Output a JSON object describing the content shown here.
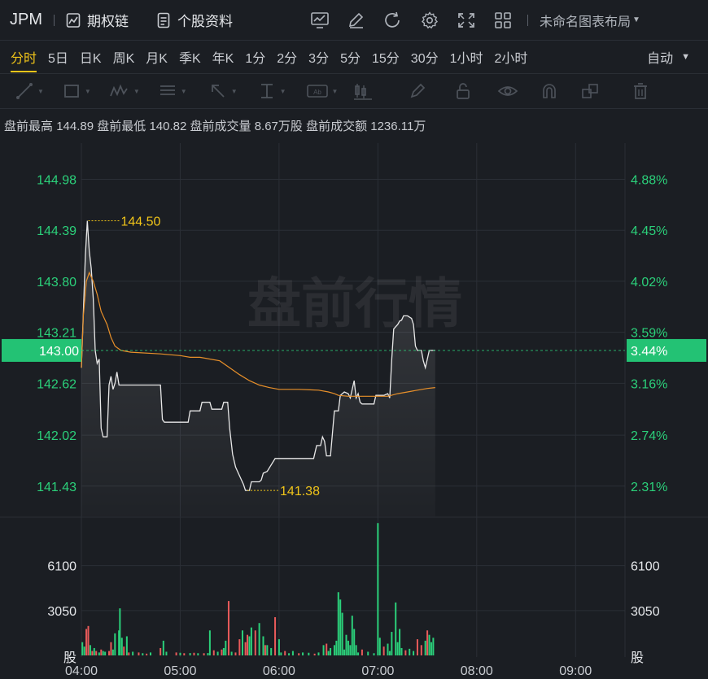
{
  "header": {
    "ticker": "JPM",
    "options_chain": "期权链",
    "profile": "个股资料",
    "layout_name": "未命名图表布局"
  },
  "periods": [
    "分时",
    "5日",
    "日K",
    "周K",
    "月K",
    "季K",
    "年K",
    "1分",
    "2分",
    "3分",
    "5分",
    "15分",
    "30分",
    "1小时",
    "2小时"
  ],
  "active_period": "分时",
  "auto_label": "自动",
  "stats": {
    "high_label": "盘前最高",
    "high": "144.89",
    "low_label": "盘前最低",
    "low": "140.82",
    "vol_label": "盘前成交量",
    "vol": "8.67万股",
    "amt_label": "盘前成交额",
    "amt": "1236.11万"
  },
  "colors": {
    "price_line": "#e8e8e8",
    "avg_line": "#e8902a",
    "up": "#2bd07a",
    "down": "#e85a5a",
    "accent": "#f0c419",
    "label_bg": "#23c274"
  },
  "chart_data": {
    "type": "line",
    "watermark": "盘前行情",
    "price_ticks": [
      "144.98",
      "144.39",
      "143.80",
      "143.21",
      "142.62",
      "142.02",
      "141.43"
    ],
    "pct_ticks": [
      "4.88%",
      "4.45%",
      "4.02%",
      "3.59%",
      "3.16%",
      "2.74%",
      "2.31%"
    ],
    "ylim": [
      141.08,
      145.38
    ],
    "current": {
      "price": "143.00",
      "pct": "3.44%",
      "value": 143.0
    },
    "high_mark": {
      "label": "144.50",
      "x": 4.07,
      "y": 144.5
    },
    "low_mark": {
      "label": "141.38",
      "x": 5.68,
      "y": 141.38
    },
    "x_ticks": [
      "04:00",
      "05:00",
      "06:00",
      "07:00",
      "08:00",
      "09:00"
    ],
    "xlim": [
      4.0,
      9.5
    ],
    "price": [
      [
        4.0,
        142.8
      ],
      [
        4.04,
        144.1
      ],
      [
        4.06,
        144.5
      ],
      [
        4.08,
        144.15
      ],
      [
        4.1,
        143.95
      ],
      [
        4.12,
        143.6
      ],
      [
        4.14,
        143.0
      ],
      [
        4.16,
        142.85
      ],
      [
        4.18,
        142.9
      ],
      [
        4.2,
        142.1
      ],
      [
        4.22,
        142.0
      ],
      [
        4.26,
        142.0
      ],
      [
        4.28,
        142.6
      ],
      [
        4.3,
        142.7
      ],
      [
        4.32,
        142.55
      ],
      [
        4.34,
        142.62
      ],
      [
        4.36,
        142.75
      ],
      [
        4.38,
        142.6
      ],
      [
        4.42,
        142.6
      ],
      [
        4.7,
        142.6
      ],
      [
        4.8,
        142.6
      ],
      [
        4.82,
        142.2
      ],
      [
        4.84,
        142.17
      ],
      [
        4.9,
        142.17
      ],
      [
        5.0,
        142.17
      ],
      [
        5.08,
        142.17
      ],
      [
        5.1,
        142.3
      ],
      [
        5.16,
        142.3
      ],
      [
        5.2,
        142.3
      ],
      [
        5.22,
        142.4
      ],
      [
        5.3,
        142.4
      ],
      [
        5.32,
        142.32
      ],
      [
        5.42,
        142.32
      ],
      [
        5.44,
        142.4
      ],
      [
        5.48,
        142.4
      ],
      [
        5.5,
        142.1
      ],
      [
        5.53,
        141.8
      ],
      [
        5.56,
        141.65
      ],
      [
        5.6,
        141.55
      ],
      [
        5.64,
        141.45
      ],
      [
        5.66,
        141.38
      ],
      [
        5.7,
        141.38
      ],
      [
        5.72,
        141.48
      ],
      [
        5.8,
        141.48
      ],
      [
        5.82,
        141.5
      ],
      [
        5.84,
        141.58
      ],
      [
        5.88,
        141.6
      ],
      [
        5.96,
        141.75
      ],
      [
        6.1,
        141.75
      ],
      [
        6.2,
        141.75
      ],
      [
        6.35,
        141.75
      ],
      [
        6.38,
        141.9
      ],
      [
        6.42,
        141.9
      ],
      [
        6.44,
        142.0
      ],
      [
        6.46,
        141.95
      ],
      [
        6.48,
        141.78
      ],
      [
        6.52,
        141.78
      ],
      [
        6.56,
        142.3
      ],
      [
        6.6,
        142.3
      ],
      [
        6.62,
        142.48
      ],
      [
        6.66,
        142.52
      ],
      [
        6.7,
        142.5
      ],
      [
        6.72,
        142.45
      ],
      [
        6.74,
        142.55
      ],
      [
        6.76,
        142.65
      ],
      [
        6.78,
        142.45
      ],
      [
        6.8,
        142.5
      ],
      [
        6.82,
        142.4
      ],
      [
        6.84,
        142.38
      ],
      [
        6.9,
        142.38
      ],
      [
        6.96,
        142.38
      ],
      [
        6.98,
        142.48
      ],
      [
        7.02,
        142.48
      ],
      [
        7.06,
        142.48
      ],
      [
        7.1,
        142.5
      ],
      [
        7.12,
        142.45
      ],
      [
        7.14,
        142.9
      ],
      [
        7.16,
        143.25
      ],
      [
        7.2,
        143.3
      ],
      [
        7.22,
        143.34
      ],
      [
        7.24,
        143.35
      ],
      [
        7.26,
        143.4
      ],
      [
        7.3,
        143.4
      ],
      [
        7.34,
        143.37
      ],
      [
        7.36,
        143.3
      ],
      [
        7.38,
        143.05
      ],
      [
        7.4,
        143.0
      ],
      [
        7.44,
        143.0
      ],
      [
        7.46,
        142.88
      ],
      [
        7.48,
        142.8
      ],
      [
        7.5,
        142.9
      ],
      [
        7.52,
        143.0
      ],
      [
        7.58,
        143.0
      ]
    ],
    "avg": [
      [
        4.0,
        142.8
      ],
      [
        4.02,
        143.4
      ],
      [
        4.05,
        143.8
      ],
      [
        4.08,
        143.9
      ],
      [
        4.12,
        143.8
      ],
      [
        4.16,
        143.65
      ],
      [
        4.2,
        143.45
      ],
      [
        4.26,
        143.3
      ],
      [
        4.3,
        143.15
      ],
      [
        4.34,
        143.05
      ],
      [
        4.4,
        143.0
      ],
      [
        4.5,
        142.98
      ],
      [
        4.8,
        142.96
      ],
      [
        5.0,
        142.94
      ],
      [
        5.1,
        142.92
      ],
      [
        5.2,
        142.92
      ],
      [
        5.4,
        142.88
      ],
      [
        5.5,
        142.8
      ],
      [
        5.6,
        142.72
      ],
      [
        5.7,
        142.65
      ],
      [
        5.8,
        142.6
      ],
      [
        5.9,
        142.57
      ],
      [
        6.0,
        142.55
      ],
      [
        6.2,
        142.55
      ],
      [
        6.4,
        142.54
      ],
      [
        6.5,
        142.52
      ],
      [
        6.56,
        142.5
      ],
      [
        6.6,
        142.48
      ],
      [
        6.7,
        142.47
      ],
      [
        6.8,
        142.47
      ],
      [
        6.9,
        142.47
      ],
      [
        7.0,
        142.47
      ],
      [
        7.1,
        142.47
      ],
      [
        7.2,
        142.5
      ],
      [
        7.3,
        142.52
      ],
      [
        7.4,
        142.54
      ],
      [
        7.5,
        142.56
      ],
      [
        7.58,
        142.57
      ]
    ],
    "volume": {
      "yticks": [
        "6100",
        "3050"
      ],
      "ytick_values": [
        6100,
        3050
      ],
      "unit": "股",
      "ylim": [
        0,
        9400
      ],
      "bars": [
        [
          4.01,
          900,
          "up"
        ],
        [
          4.03,
          600,
          "up"
        ],
        [
          4.05,
          1800,
          "down"
        ],
        [
          4.07,
          2000,
          "down"
        ],
        [
          4.09,
          700,
          "up"
        ],
        [
          4.11,
          300,
          "down"
        ],
        [
          4.13,
          500,
          "up"
        ],
        [
          4.15,
          300,
          "down"
        ],
        [
          4.18,
          200,
          "up"
        ],
        [
          4.2,
          400,
          "down"
        ],
        [
          4.22,
          300,
          "up"
        ],
        [
          4.24,
          250,
          "up"
        ],
        [
          4.28,
          300,
          "down"
        ],
        [
          4.3,
          900,
          "down"
        ],
        [
          4.32,
          400,
          "up"
        ],
        [
          4.34,
          1500,
          "up"
        ],
        [
          4.38,
          1700,
          "up"
        ],
        [
          4.39,
          3200,
          "up"
        ],
        [
          4.41,
          1200,
          "up"
        ],
        [
          4.43,
          600,
          "down"
        ],
        [
          4.46,
          1300,
          "up"
        ],
        [
          4.48,
          200,
          "down"
        ],
        [
          4.52,
          250,
          "up"
        ],
        [
          4.58,
          200,
          "down"
        ],
        [
          4.62,
          150,
          "up"
        ],
        [
          4.66,
          120,
          "down"
        ],
        [
          4.7,
          200,
          "up"
        ],
        [
          4.8,
          500,
          "down"
        ],
        [
          4.83,
          1000,
          "up"
        ],
        [
          4.86,
          250,
          "up"
        ],
        [
          4.96,
          200,
          "down"
        ],
        [
          5.0,
          180,
          "up"
        ],
        [
          5.04,
          150,
          "down"
        ],
        [
          5.1,
          160,
          "up"
        ],
        [
          5.14,
          180,
          "down"
        ],
        [
          5.18,
          150,
          "up"
        ],
        [
          5.24,
          150,
          "down"
        ],
        [
          5.28,
          160,
          "up"
        ],
        [
          5.3,
          1700,
          "up"
        ],
        [
          5.34,
          350,
          "down"
        ],
        [
          5.38,
          250,
          "up"
        ],
        [
          5.42,
          400,
          "down"
        ],
        [
          5.44,
          500,
          "up"
        ],
        [
          5.46,
          1000,
          "up"
        ],
        [
          5.49,
          3700,
          "down"
        ],
        [
          5.52,
          250,
          "up"
        ],
        [
          5.56,
          200,
          "down"
        ],
        [
          5.6,
          1100,
          "down"
        ],
        [
          5.63,
          1700,
          "up"
        ],
        [
          5.66,
          900,
          "down"
        ],
        [
          5.68,
          1400,
          "down"
        ],
        [
          5.7,
          1300,
          "up"
        ],
        [
          5.72,
          1900,
          "up"
        ],
        [
          5.76,
          1700,
          "down"
        ],
        [
          5.8,
          2200,
          "up"
        ],
        [
          5.84,
          1300,
          "up"
        ],
        [
          5.86,
          700,
          "down"
        ],
        [
          5.88,
          700,
          "up"
        ],
        [
          5.92,
          500,
          "up"
        ],
        [
          5.96,
          2600,
          "down"
        ],
        [
          6.0,
          1100,
          "up"
        ],
        [
          6.02,
          200,
          "up"
        ],
        [
          6.06,
          300,
          "down"
        ],
        [
          6.1,
          150,
          "up"
        ],
        [
          6.14,
          300,
          "up"
        ],
        [
          6.2,
          150,
          "down"
        ],
        [
          6.24,
          200,
          "up"
        ],
        [
          6.3,
          180,
          "up"
        ],
        [
          6.36,
          120,
          "down"
        ],
        [
          6.4,
          200,
          "up"
        ],
        [
          6.45,
          700,
          "up"
        ],
        [
          6.48,
          800,
          "down"
        ],
        [
          6.5,
          300,
          "up"
        ],
        [
          6.52,
          500,
          "up"
        ],
        [
          6.56,
          700,
          "up"
        ],
        [
          6.58,
          1000,
          "up"
        ],
        [
          6.6,
          4300,
          "up"
        ],
        [
          6.62,
          3800,
          "up"
        ],
        [
          6.64,
          2900,
          "up"
        ],
        [
          6.66,
          400,
          "up"
        ],
        [
          6.68,
          1400,
          "up"
        ],
        [
          6.7,
          1000,
          "up"
        ],
        [
          6.72,
          700,
          "up"
        ],
        [
          6.74,
          2700,
          "up"
        ],
        [
          6.76,
          1800,
          "up"
        ],
        [
          6.78,
          700,
          "up"
        ],
        [
          6.8,
          200,
          "up"
        ],
        [
          6.84,
          400,
          "down"
        ],
        [
          6.9,
          250,
          "up"
        ],
        [
          6.96,
          150,
          "up"
        ],
        [
          7.0,
          9000,
          "up"
        ],
        [
          7.02,
          1200,
          "up"
        ],
        [
          7.06,
          600,
          "down"
        ],
        [
          7.1,
          800,
          "up"
        ],
        [
          7.12,
          300,
          "up"
        ],
        [
          7.14,
          1600,
          "up"
        ],
        [
          7.18,
          3600,
          "up"
        ],
        [
          7.2,
          900,
          "up"
        ],
        [
          7.22,
          1800,
          "up"
        ],
        [
          7.24,
          500,
          "up"
        ],
        [
          7.28,
          350,
          "down"
        ],
        [
          7.32,
          450,
          "up"
        ],
        [
          7.36,
          300,
          "up"
        ],
        [
          7.4,
          1100,
          "down"
        ],
        [
          7.44,
          700,
          "down"
        ],
        [
          7.48,
          1000,
          "up"
        ],
        [
          7.5,
          1700,
          "down"
        ],
        [
          7.52,
          1400,
          "up"
        ],
        [
          7.54,
          900,
          "up"
        ],
        [
          7.56,
          1200,
          "up"
        ]
      ]
    }
  }
}
